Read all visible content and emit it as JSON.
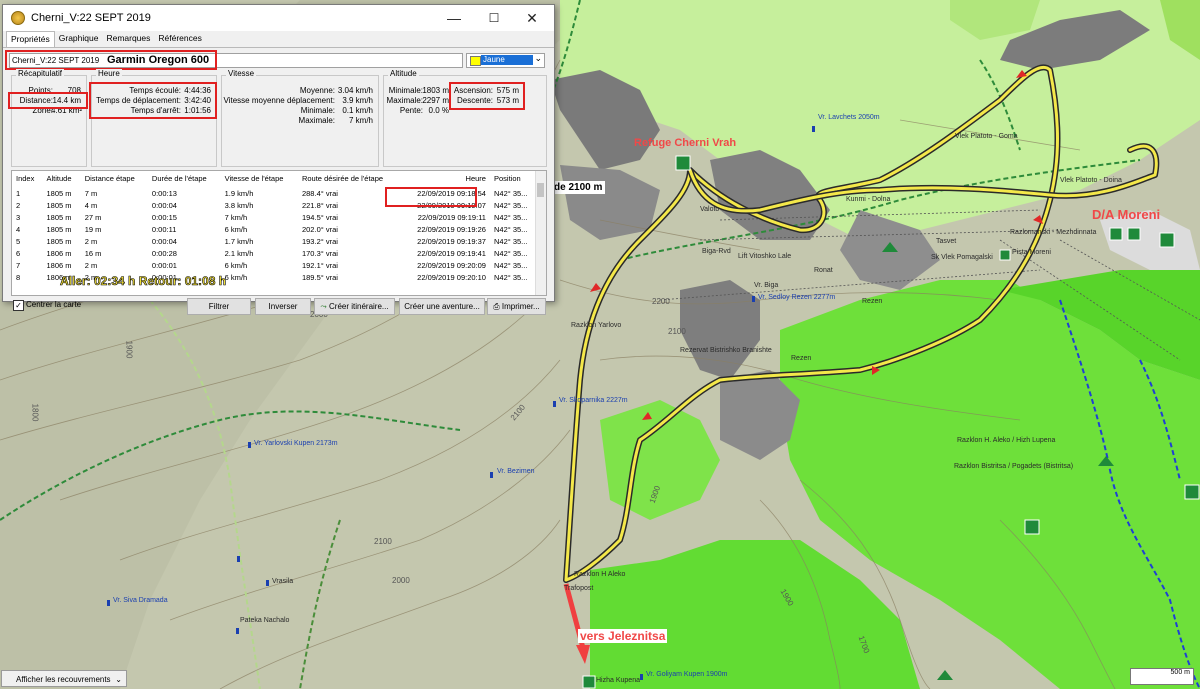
{
  "window": {
    "title": "Cherni_V:22 SEPT 2019",
    "minimize": "—",
    "maximize": "☐",
    "close": "✕"
  },
  "tabs": [
    "Propriétés",
    "Graphique",
    "Remarques",
    "Références"
  ],
  "track": {
    "name_value": "Cherni_V:22 SEPT 2019",
    "device_annotation": "Garmin Oregon 600",
    "color_label": "Jaune",
    "color_hex": "#ffff00"
  },
  "summary": {
    "label": "Récapitulatif",
    "points_label": "Points:",
    "points_value": "708",
    "distance_label": "Distance:",
    "distance_value": "14.4 km",
    "zone_label": "Zone:",
    "zone_value": "4.61 km²"
  },
  "time": {
    "label": "Heure",
    "elapsed_label": "Temps écoulé:",
    "elapsed_value": "4:44:36",
    "moving_label": "Temps de déplacement:",
    "moving_value": "3:42:40",
    "stopped_label": "Temps d'arrêt:",
    "stopped_value": "1:01:56"
  },
  "speed": {
    "label": "Vitesse",
    "avg_label": "Moyenne:",
    "avg_value": "3.04 km/h",
    "moving_avg_label": "Vitesse moyenne déplacement:",
    "moving_avg_value": "3.9 km/h",
    "min_label": "Minimale:",
    "min_value": "0.1 km/h",
    "max_label": "Maximale:",
    "max_value": "7 km/h"
  },
  "altitude": {
    "label": "Altitude",
    "min_label": "Minimale:",
    "min_value": "1803 m",
    "max_label": "Maximale:",
    "max_value": "2297 m",
    "slope_label": "Pente:",
    "slope_value": "0.0 %",
    "ascent_label": "Ascension:",
    "ascent_value": "575 m",
    "descent_label": "Descente:",
    "descent_value": "573 m"
  },
  "table": {
    "headers": [
      "Index",
      "Altitude",
      "Distance étape",
      "Durée de l'étape",
      "Vitesse de l'étape",
      "Route désirée de l'étape",
      "Heure",
      "Position"
    ],
    "rows": [
      [
        "1",
        "1805 m",
        "7 m",
        "0:00:13",
        "1.9 km/h",
        "288.4° vrai",
        "22/09/2019 09:18:54",
        "N42° 35..."
      ],
      [
        "2",
        "1805 m",
        "4 m",
        "0:00:04",
        "3.8 km/h",
        "221.8° vrai",
        "22/09/2019 09:19:07",
        "N42° 35..."
      ],
      [
        "3",
        "1805 m",
        "27 m",
        "0:00:15",
        "7 km/h",
        "194.5° vrai",
        "22/09/2019 09:19:11",
        "N42° 35..."
      ],
      [
        "4",
        "1805 m",
        "19 m",
        "0:00:11",
        "6 km/h",
        "202.0° vrai",
        "22/09/2019 09:19:26",
        "N42° 35..."
      ],
      [
        "5",
        "1805 m",
        "2 m",
        "0:00:04",
        "1.7 km/h",
        "193.2° vrai",
        "22/09/2019 09:19:37",
        "N42° 35..."
      ],
      [
        "6",
        "1806 m",
        "16 m",
        "0:00:28",
        "2.1 km/h",
        "170.3° vrai",
        "22/09/2019 09:19:41",
        "N42° 35..."
      ],
      [
        "7",
        "1806 m",
        "2 m",
        "0:00:01",
        "6 km/h",
        "192.1° vrai",
        "22/09/2019 09:20:09",
        "N42° 35..."
      ],
      [
        "8",
        "1806 m",
        "2 m",
        "0:00:01",
        "6 km/h",
        "189.5° vrai",
        "22/09/2019 09:20:10",
        "N42° 35..."
      ]
    ]
  },
  "controls": {
    "center_map_label": "Centrer la carte",
    "center_map_checked": true,
    "filter": "Filtrer",
    "invert": "Inverser",
    "create_route": "Créer itinéraire...",
    "create_adventure": "Créer une aventure...",
    "print": "Imprimer..."
  },
  "annotations": {
    "times": "Aller: 02:34 h   Retour: 01:08 h",
    "refuge": "Refuge Cherni Vrah",
    "moreni": "D/A Moreni",
    "jeleznitsa": "vers Jeleznitsa",
    "contour_2100": "de 2100 m"
  },
  "map_labels": {
    "peaks": [
      "Vr. Lavchets 2050m",
      "Vr. Sedloy Rezen 2277m",
      "Vr. Skoparnika 2227m",
      "Vr. Bezimen",
      "Vr. Yarlovski Kupen 2173m",
      "Vr. Siva Dramada",
      "Vr. Goliyam Kupen 1900m"
    ],
    "pois": [
      "Vlek Platoto - Goma",
      "Vlek Platoto - Doina",
      "Kunmi - Dolna",
      "Valoto",
      "Biga-Rvd",
      "Lift Vitoshko Lale",
      "Ronat",
      "Vr. Biga",
      "Rezen",
      "Razklon Yarlovo",
      "Rezervat Bistrishko Branishte",
      "Razklon H Aleko",
      "Trafopost",
      "Vrasila",
      "Pateka Nachalo",
      "Razklon H. Aleko / Hizh Lupena",
      "Razklon Bistritsa / Pogadets (Bistritsa)",
      "Hizha Kupena",
      "Pista Moreni",
      "Razlomanski - Mezhdinnata",
      "Tasvet",
      "Sk Vlek Pomagalski",
      "Rezen"
    ],
    "elevations": [
      "2200",
      "2100",
      "2100",
      "2000",
      "2000",
      "1900",
      "1900",
      "1800",
      "1700",
      "1900",
      "2100"
    ]
  },
  "bottom_bar": {
    "overlay_dropdown": "Afficher les recouvrements",
    "scale": "500 m"
  }
}
